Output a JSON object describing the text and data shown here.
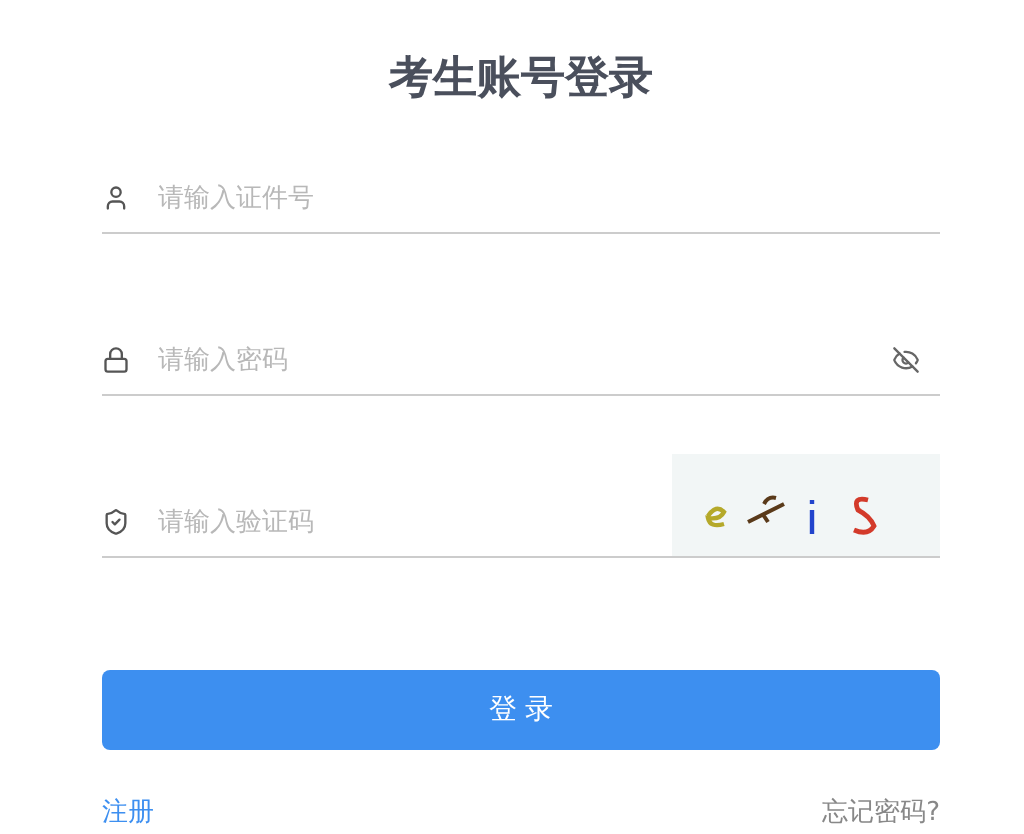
{
  "title": "考生账号登录",
  "fields": [
    {
      "kind": "user",
      "placeholder": "请输入证件号"
    },
    {
      "kind": "password",
      "placeholder": "请输入密码"
    },
    {
      "kind": "captcha",
      "placeholder": "请输入验证码"
    }
  ],
  "login_button": "登 录",
  "register_link": "注册",
  "forgot_link": "忘记密码?"
}
